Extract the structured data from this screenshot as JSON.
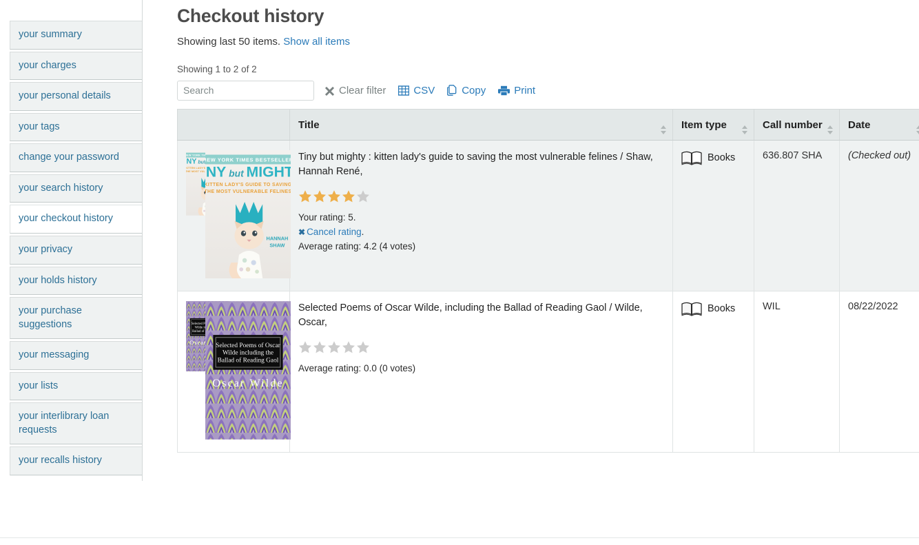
{
  "sidebar": {
    "items": [
      {
        "label": "your summary",
        "active": false
      },
      {
        "label": "your charges",
        "active": false
      },
      {
        "label": "your personal details",
        "active": false
      },
      {
        "label": "your tags",
        "active": false
      },
      {
        "label": "change your password",
        "active": false
      },
      {
        "label": "your search history",
        "active": false
      },
      {
        "label": "your checkout history",
        "active": true
      },
      {
        "label": "your privacy",
        "active": false
      },
      {
        "label": "your holds history",
        "active": false
      },
      {
        "label": "your purchase suggestions",
        "active": false
      },
      {
        "label": "your messaging",
        "active": false
      },
      {
        "label": "your lists",
        "active": false
      },
      {
        "label": "your interlibrary loan requests",
        "active": false
      },
      {
        "label": "your recalls history",
        "active": false
      }
    ]
  },
  "main": {
    "title": "Checkout history",
    "showing_prefix": "Showing last 50 items.",
    "show_all_link": "Show all items",
    "datatable_info": "Showing 1 to 2 of 2",
    "search": {
      "placeholder": "Search",
      "value": ""
    },
    "toolbar": {
      "clear_filter": "Clear filter",
      "csv": "CSV",
      "copy": "Copy",
      "print": "Print"
    },
    "table": {
      "columns": [
        {
          "label": "",
          "sortable": false
        },
        {
          "label": "Title",
          "sortable": true
        },
        {
          "label": "Item type",
          "sortable": true
        },
        {
          "label": "Call number",
          "sortable": true
        },
        {
          "label": "Date",
          "sortable": true
        }
      ],
      "rows": [
        {
          "title": "Tiny but mighty : kitten lady's guide to saving the most vulnerable felines / Shaw, Hannah René,",
          "cover_title_line1": "NEW YORK TIMES BESTSELLER",
          "cover_title_main_a": "TINY",
          "cover_title_main_b": "but",
          "cover_title_main_c": "MIGHTY",
          "cover_subtitle": "KITTEN LADY'S GUIDE TO SAVING THE MOST VULNERABLE FELINES",
          "cover_author": "HANNAH SHAW",
          "stars_filled": 4,
          "stars_total": 5,
          "your_rating": "Your rating: 5.",
          "cancel_rating": "Cancel rating",
          "cancel_rating_suffix": ".",
          "average_rating": "Average rating: 4.2 (4 votes)",
          "item_type": "Books",
          "call_number": "636.807 SHA",
          "date": "(Checked out)",
          "date_italic": true
        },
        {
          "title": "Selected Poems of Oscar Wilde, including the Ballad of Reading Gaol / Wilde, Oscar,",
          "cover_box_text": "Selected Poems of Oscar Wilde including the Ballad of Reading Gaol",
          "cover_author": "Oscar Wilde",
          "stars_filled": 0,
          "stars_total": 5,
          "your_rating": "",
          "cancel_rating": "",
          "average_rating": "Average rating: 0.0 (0 votes)",
          "item_type": "Books",
          "call_number": "WIL",
          "date": "08/22/2022",
          "date_italic": false
        }
      ]
    }
  },
  "colors": {
    "link": "#2b7bb9",
    "sidebar_link": "#2d7096",
    "star_filled": "#eeaf4a",
    "star_empty": "#cccccc",
    "header_bg": "#e3e8e8",
    "row_odd_bg": "#eff2f2"
  },
  "icons": {
    "clear_filter": "x-mark-icon",
    "csv": "table-grid-icon",
    "copy": "copy-pages-icon",
    "print": "printer-icon",
    "item_type": "open-book-icon",
    "sort": "sort-arrows-icon"
  }
}
